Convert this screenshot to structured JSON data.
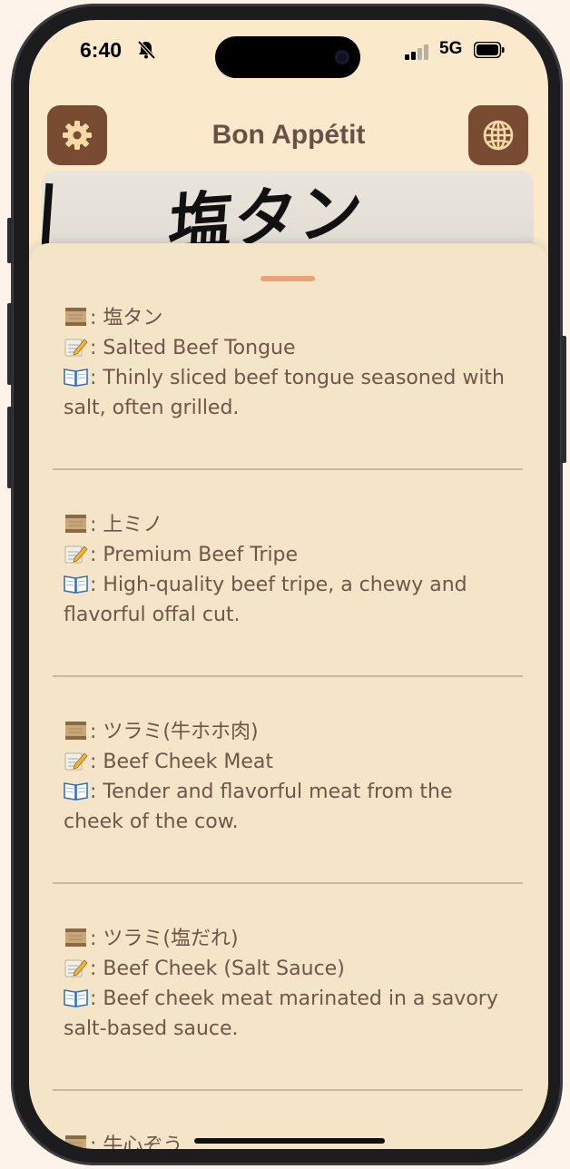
{
  "status_bar": {
    "time": "6:40",
    "network": "5G"
  },
  "header": {
    "title": "Bon Appétit",
    "settings_icon": "gear-icon",
    "language_icon": "globe-icon"
  },
  "photo": {
    "text": "塩タン"
  },
  "items": [
    {
      "original": ": 塩タン",
      "translation": ": Salted Beef Tongue",
      "description": ": Thinly sliced beef tongue seasoned with salt, often grilled."
    },
    {
      "original": ": 上ミノ",
      "translation": ": Premium Beef Tripe",
      "description": ": High-quality beef tripe, a chewy and flavorful offal cut."
    },
    {
      "original": ": ツラミ(牛ホホ肉)",
      "translation": ": Beef Cheek Meat",
      "description": ": Tender and flavorful meat from the cheek of the cow."
    },
    {
      "original": ": ツラミ(塩だれ)",
      "translation": ": Beef Cheek (Salt Sauce)",
      "description": ": Beef cheek meat marinated in a savory salt-based sauce."
    },
    {
      "original": ": 牛心ぞう",
      "translation": "",
      "description": ""
    }
  ],
  "emoji_icons": [
    "scroll-icon",
    "memo-icon",
    "open-book-icon"
  ],
  "colors": {
    "background": "#faeacb",
    "sheet": "#f5e5c8",
    "button": "#7a4b33",
    "title": "#6b5046",
    "text": "#6e5649",
    "grabber": "#eaa27a",
    "divider": "#c9b99f"
  }
}
